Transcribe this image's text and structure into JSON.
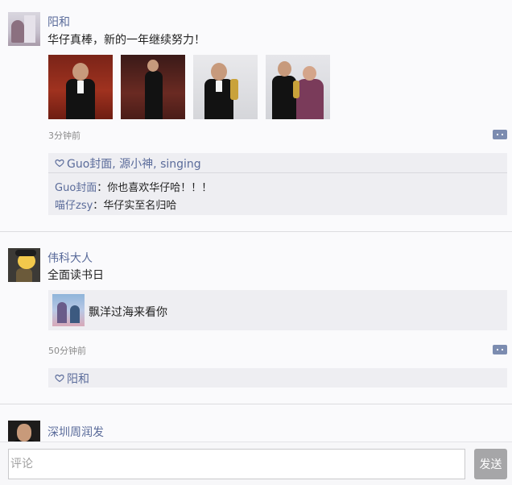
{
  "posts": [
    {
      "author": "阳和",
      "text": "华仔真棒，新的一年继续努力！",
      "time": "3分钟前",
      "likes": "Guo封面, 源小神, singing",
      "replies": [
        {
          "author": "Guo封面",
          "sep": "：",
          "text": "你也喜欢华仔哈！！！"
        },
        {
          "author": "喵仔zsy",
          "sep": "：",
          "text": "华仔实至名归哈"
        }
      ]
    },
    {
      "author": "伟科大人",
      "text": "全面读书日",
      "shared_title": "飘洋过海来看你",
      "time": "50分钟前",
      "likes": "阳和"
    },
    {
      "author": "深圳周润发"
    }
  ],
  "composer": {
    "placeholder": "评论",
    "send_label": "发送"
  },
  "colors": {
    "link": "#5a6b9a",
    "send_button": "#a6a6a8",
    "panel": "#eeeef2"
  }
}
